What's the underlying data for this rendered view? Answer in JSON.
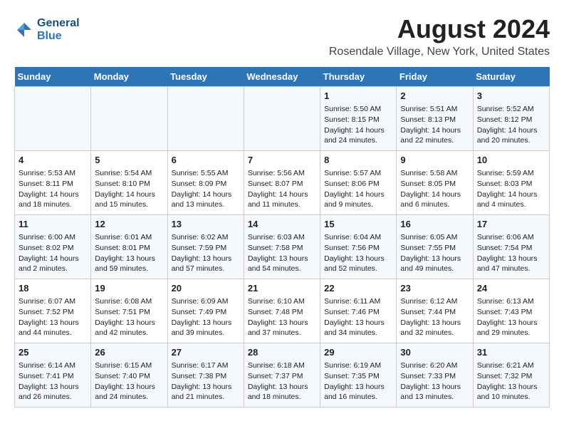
{
  "logo": {
    "text_line1": "General",
    "text_line2": "Blue"
  },
  "header": {
    "title": "August 2024",
    "subtitle": "Rosendale Village, New York, United States"
  },
  "weekdays": [
    "Sunday",
    "Monday",
    "Tuesday",
    "Wednesday",
    "Thursday",
    "Friday",
    "Saturday"
  ],
  "weeks": [
    [
      {
        "day": "",
        "info": ""
      },
      {
        "day": "",
        "info": ""
      },
      {
        "day": "",
        "info": ""
      },
      {
        "day": "",
        "info": ""
      },
      {
        "day": "1",
        "info": "Sunrise: 5:50 AM\nSunset: 8:15 PM\nDaylight: 14 hours\nand 24 minutes."
      },
      {
        "day": "2",
        "info": "Sunrise: 5:51 AM\nSunset: 8:13 PM\nDaylight: 14 hours\nand 22 minutes."
      },
      {
        "day": "3",
        "info": "Sunrise: 5:52 AM\nSunset: 8:12 PM\nDaylight: 14 hours\nand 20 minutes."
      }
    ],
    [
      {
        "day": "4",
        "info": "Sunrise: 5:53 AM\nSunset: 8:11 PM\nDaylight: 14 hours\nand 18 minutes."
      },
      {
        "day": "5",
        "info": "Sunrise: 5:54 AM\nSunset: 8:10 PM\nDaylight: 14 hours\nand 15 minutes."
      },
      {
        "day": "6",
        "info": "Sunrise: 5:55 AM\nSunset: 8:09 PM\nDaylight: 14 hours\nand 13 minutes."
      },
      {
        "day": "7",
        "info": "Sunrise: 5:56 AM\nSunset: 8:07 PM\nDaylight: 14 hours\nand 11 minutes."
      },
      {
        "day": "8",
        "info": "Sunrise: 5:57 AM\nSunset: 8:06 PM\nDaylight: 14 hours\nand 9 minutes."
      },
      {
        "day": "9",
        "info": "Sunrise: 5:58 AM\nSunset: 8:05 PM\nDaylight: 14 hours\nand 6 minutes."
      },
      {
        "day": "10",
        "info": "Sunrise: 5:59 AM\nSunset: 8:03 PM\nDaylight: 14 hours\nand 4 minutes."
      }
    ],
    [
      {
        "day": "11",
        "info": "Sunrise: 6:00 AM\nSunset: 8:02 PM\nDaylight: 14 hours\nand 2 minutes."
      },
      {
        "day": "12",
        "info": "Sunrise: 6:01 AM\nSunset: 8:01 PM\nDaylight: 13 hours\nand 59 minutes."
      },
      {
        "day": "13",
        "info": "Sunrise: 6:02 AM\nSunset: 7:59 PM\nDaylight: 13 hours\nand 57 minutes."
      },
      {
        "day": "14",
        "info": "Sunrise: 6:03 AM\nSunset: 7:58 PM\nDaylight: 13 hours\nand 54 minutes."
      },
      {
        "day": "15",
        "info": "Sunrise: 6:04 AM\nSunset: 7:56 PM\nDaylight: 13 hours\nand 52 minutes."
      },
      {
        "day": "16",
        "info": "Sunrise: 6:05 AM\nSunset: 7:55 PM\nDaylight: 13 hours\nand 49 minutes."
      },
      {
        "day": "17",
        "info": "Sunrise: 6:06 AM\nSunset: 7:54 PM\nDaylight: 13 hours\nand 47 minutes."
      }
    ],
    [
      {
        "day": "18",
        "info": "Sunrise: 6:07 AM\nSunset: 7:52 PM\nDaylight: 13 hours\nand 44 minutes."
      },
      {
        "day": "19",
        "info": "Sunrise: 6:08 AM\nSunset: 7:51 PM\nDaylight: 13 hours\nand 42 minutes."
      },
      {
        "day": "20",
        "info": "Sunrise: 6:09 AM\nSunset: 7:49 PM\nDaylight: 13 hours\nand 39 minutes."
      },
      {
        "day": "21",
        "info": "Sunrise: 6:10 AM\nSunset: 7:48 PM\nDaylight: 13 hours\nand 37 minutes."
      },
      {
        "day": "22",
        "info": "Sunrise: 6:11 AM\nSunset: 7:46 PM\nDaylight: 13 hours\nand 34 minutes."
      },
      {
        "day": "23",
        "info": "Sunrise: 6:12 AM\nSunset: 7:44 PM\nDaylight: 13 hours\nand 32 minutes."
      },
      {
        "day": "24",
        "info": "Sunrise: 6:13 AM\nSunset: 7:43 PM\nDaylight: 13 hours\nand 29 minutes."
      }
    ],
    [
      {
        "day": "25",
        "info": "Sunrise: 6:14 AM\nSunset: 7:41 PM\nDaylight: 13 hours\nand 26 minutes."
      },
      {
        "day": "26",
        "info": "Sunrise: 6:15 AM\nSunset: 7:40 PM\nDaylight: 13 hours\nand 24 minutes."
      },
      {
        "day": "27",
        "info": "Sunrise: 6:17 AM\nSunset: 7:38 PM\nDaylight: 13 hours\nand 21 minutes."
      },
      {
        "day": "28",
        "info": "Sunrise: 6:18 AM\nSunset: 7:37 PM\nDaylight: 13 hours\nand 18 minutes."
      },
      {
        "day": "29",
        "info": "Sunrise: 6:19 AM\nSunset: 7:35 PM\nDaylight: 13 hours\nand 16 minutes."
      },
      {
        "day": "30",
        "info": "Sunrise: 6:20 AM\nSunset: 7:33 PM\nDaylight: 13 hours\nand 13 minutes."
      },
      {
        "day": "31",
        "info": "Sunrise: 6:21 AM\nSunset: 7:32 PM\nDaylight: 13 hours\nand 10 minutes."
      }
    ]
  ]
}
